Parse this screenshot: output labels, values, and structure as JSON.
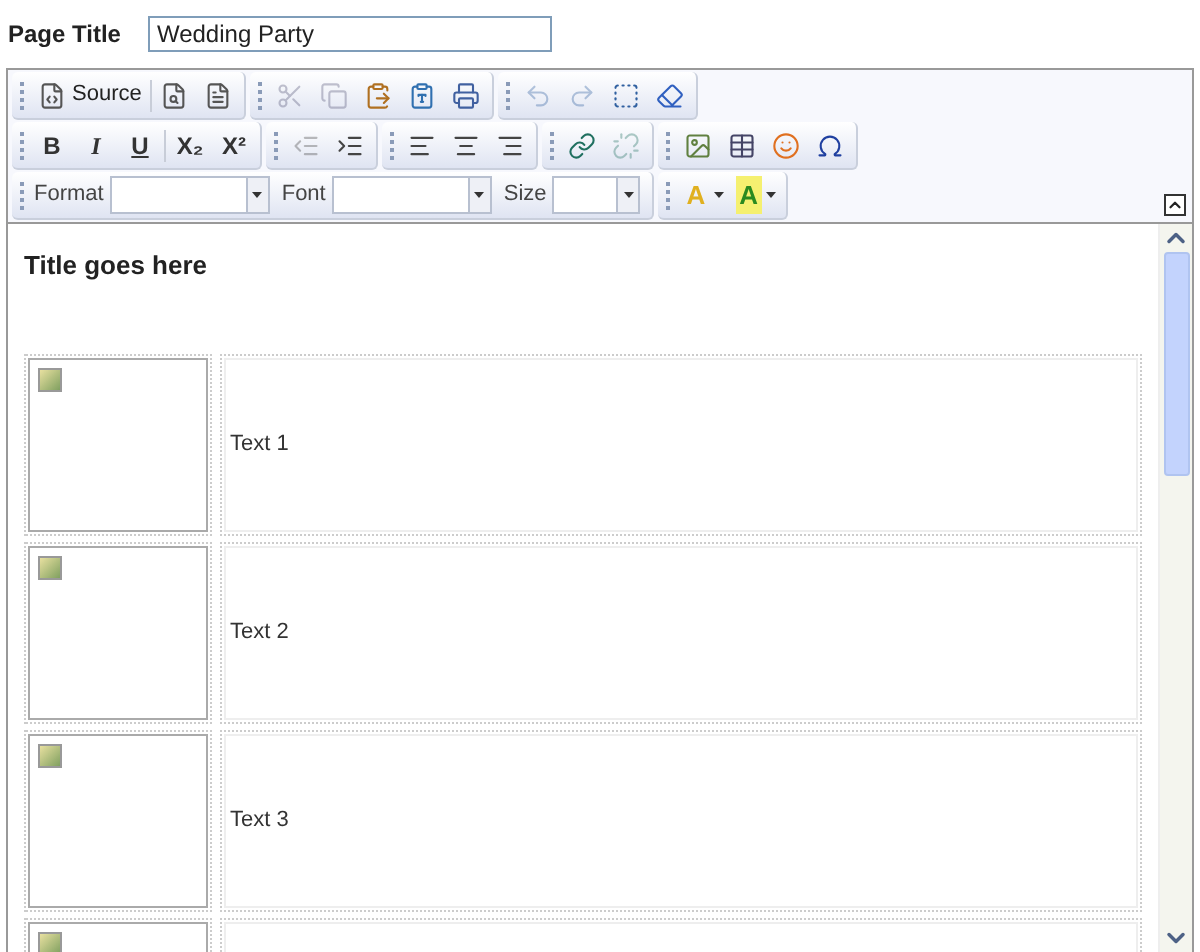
{
  "page_title": {
    "label": "Page Title",
    "value": "Wedding Party"
  },
  "toolbar": [
    [
      [
        {
          "kind": "icon_label",
          "label": "Source",
          "disabled": false
        },
        {
          "kind": "icon",
          "disabled": false
        },
        {
          "kind": "icon",
          "disabled": false
        }
      ],
      [
        {
          "kind": "icon",
          "disabled": true
        },
        {
          "kind": "icon",
          "disabled": true
        },
        {
          "kind": "icon",
          "disabled": false
        },
        {
          "kind": "icon",
          "disabled": false
        },
        {
          "kind": "icon",
          "disabled": false
        }
      ],
      [
        {
          "kind": "icon",
          "disabled": true
        },
        {
          "kind": "icon",
          "disabled": true
        },
        {
          "kind": "icon",
          "disabled": false
        },
        {
          "kind": "icon",
          "disabled": false
        }
      ]
    ],
    [
      [
        {
          "kind": "text",
          "label": "B"
        },
        {
          "kind": "text",
          "label": "I"
        },
        {
          "kind": "text",
          "label": "U"
        },
        {
          "kind": "text",
          "label": "X₂"
        },
        {
          "kind": "text",
          "label": "X²"
        }
      ],
      [
        {
          "kind": "icon",
          "disabled": true
        },
        {
          "kind": "icon",
          "disabled": false
        }
      ],
      [
        {
          "kind": "icon",
          "disabled": false
        },
        {
          "kind": "icon",
          "disabled": false
        },
        {
          "kind": "icon",
          "disabled": false
        }
      ],
      [
        {
          "kind": "icon",
          "disabled": false
        },
        {
          "kind": "icon",
          "disabled": true
        }
      ],
      [
        {
          "kind": "icon",
          "disabled": false
        },
        {
          "kind": "icon",
          "disabled": false
        },
        {
          "kind": "icon",
          "disabled": false
        },
        {
          "kind": "icon",
          "disabled": false
        }
      ]
    ],
    [
      [
        {
          "kind": "combo",
          "label": "Format"
        },
        {
          "kind": "combo",
          "label": "Font"
        },
        {
          "kind": "combo",
          "label": "Size"
        }
      ],
      [
        {
          "kind": "text_color",
          "label": "A",
          "color": "#e0b020"
        },
        {
          "kind": "bg_color",
          "label": "A",
          "color": "#f5f070"
        }
      ]
    ]
  ],
  "editor": {
    "title": "Title goes here",
    "rows": [
      {
        "text": "Text 1"
      },
      {
        "text": "Text 2"
      },
      {
        "text": "Text 3"
      },
      {}
    ]
  }
}
